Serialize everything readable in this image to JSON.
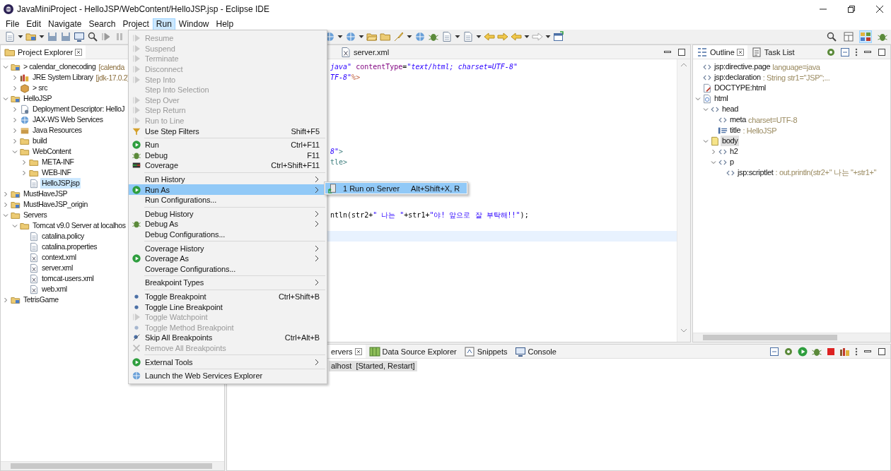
{
  "window": {
    "title": "JavaMiniProject - HelloJSP/WebContent/HelloJSP.jsp - Eclipse IDE"
  },
  "menubar": [
    {
      "label": "File",
      "selected": false
    },
    {
      "label": "Edit",
      "selected": false
    },
    {
      "label": "Navigate",
      "selected": false
    },
    {
      "label": "Search",
      "selected": false
    },
    {
      "label": "Project",
      "selected": false
    },
    {
      "label": "Run",
      "selected": true
    },
    {
      "label": "Window",
      "selected": false
    },
    {
      "label": "Help",
      "selected": false
    }
  ],
  "project_explorer": {
    "tab": {
      "label": "Project Explorer",
      "selected": true
    },
    "items": [
      {
        "label": "> calendar_clonecoding",
        "detail": "[calenda",
        "kind": "project",
        "expanded": true,
        "selected": false,
        "children": [
          {
            "label": "JRE System Library",
            "detail": "[jdk-17.0.2]",
            "kind": "library",
            "expanded": false,
            "selected": false
          },
          {
            "label": "> src",
            "kind": "source",
            "expanded": false,
            "selected": false
          }
        ]
      },
      {
        "label": "HelloJSP",
        "kind": "project",
        "expanded": true,
        "selected": false,
        "children": [
          {
            "label": "Deployment Descriptor: HelloJ",
            "kind": "descriptor",
            "expanded": false,
            "selected": false
          },
          {
            "label": "JAX-WS Web Services",
            "kind": "services",
            "expanded": false,
            "selected": false
          },
          {
            "label": "Java Resources",
            "kind": "resources",
            "expanded": false,
            "selected": false
          },
          {
            "label": "build",
            "kind": "folder",
            "expanded": false,
            "selected": false
          },
          {
            "label": "WebContent",
            "kind": "folder",
            "expanded": true,
            "selected": false,
            "children": [
              {
                "label": "META-INF",
                "kind": "folder",
                "expanded": false,
                "selected": false
              },
              {
                "label": "WEB-INF",
                "kind": "folder",
                "expanded": false,
                "selected": false
              },
              {
                "label": "HelloJSP.jsp",
                "kind": "file",
                "selected": true
              }
            ]
          }
        ]
      },
      {
        "label": "MustHaveJSP",
        "kind": "project",
        "expanded": false,
        "selected": false
      },
      {
        "label": "MustHaveJSP_origin",
        "kind": "project",
        "expanded": false,
        "selected": false
      },
      {
        "label": "Servers",
        "kind": "folder",
        "expanded": true,
        "selected": false,
        "children": [
          {
            "label": "Tomcat v9.0 Server at localhos",
            "kind": "folder",
            "expanded": true,
            "selected": false,
            "children": [
              {
                "label": "catalina.policy",
                "kind": "file",
                "selected": false
              },
              {
                "label": "catalina.properties",
                "kind": "file",
                "selected": false
              },
              {
                "label": "context.xml",
                "kind": "xml",
                "selected": false
              },
              {
                "label": "server.xml",
                "kind": "xml",
                "selected": false
              },
              {
                "label": "tomcat-users.xml",
                "kind": "xml",
                "selected": false
              },
              {
                "label": "web.xml",
                "kind": "xml",
                "selected": false
              }
            ]
          }
        ]
      },
      {
        "label": "TetrisGame",
        "kind": "project",
        "expanded": false,
        "selected": false
      }
    ]
  },
  "editor": {
    "tabs": [
      {
        "label": "server.xml",
        "selected": false
      }
    ],
    "lines": [
      {
        "kind": "code",
        "segments": [
          {
            "text": "java\"",
            "kind": "string"
          },
          {
            "text": " contentType",
            "kind": "attr"
          },
          {
            "text": "=",
            "kind": "plain"
          },
          {
            "text": "\"text/html; charset=UTF-8\"",
            "kind": "string"
          }
        ]
      },
      {
        "kind": "code",
        "segments": [
          {
            "text": "TF-8\"",
            "kind": "string"
          },
          {
            "text": "%>",
            "kind": "delim"
          }
        ]
      },
      {
        "kind": "blank"
      },
      {
        "kind": "blank"
      },
      {
        "kind": "blank"
      },
      {
        "kind": "blank"
      },
      {
        "kind": "blank"
      },
      {
        "kind": "blank"
      },
      {
        "kind": "code",
        "segments": [
          {
            "text": "8\"",
            "kind": "string"
          },
          {
            "text": ">",
            "kind": "tag"
          }
        ]
      },
      {
        "kind": "code",
        "segments": [
          {
            "text": "tle>",
            "kind": "tag"
          }
        ]
      },
      {
        "kind": "blank"
      },
      {
        "kind": "blank"
      },
      {
        "kind": "blank"
      },
      {
        "kind": "blank"
      },
      {
        "kind": "code",
        "segments": [
          {
            "text": "ntln(str2+",
            "kind": "plain"
          },
          {
            "text": "\" 나는 \"",
            "kind": "jstring"
          },
          {
            "text": "+str1+",
            "kind": "plain"
          },
          {
            "text": "\"야! 앞으로 잘 부탁해!!\"",
            "kind": "jstring"
          },
          {
            "text": ");",
            "kind": "plain"
          }
        ]
      },
      {
        "kind": "blank"
      },
      {
        "kind": "blank",
        "current": true
      }
    ]
  },
  "outline": {
    "tabs": [
      {
        "label": "Outline",
        "selected": true
      },
      {
        "label": "Task List",
        "selected": false
      }
    ],
    "items": [
      {
        "label": "jsp:directive.page",
        "detail": "language=java",
        "kind": "tag",
        "selected": false
      },
      {
        "label": "jsp:declaration",
        "detail": ": String str1=\"JSP\";...",
        "kind": "tag",
        "selected": false
      },
      {
        "label": "DOCTYPE:html",
        "kind": "doctype",
        "selected": false
      },
      {
        "label": "html",
        "kind": "html",
        "expanded": true,
        "selected": false,
        "children": [
          {
            "label": "head",
            "kind": "tag",
            "expanded": true,
            "selected": false,
            "children": [
              {
                "label": "meta",
                "detail": "charset=UTF-8",
                "kind": "tag",
                "selected": false
              },
              {
                "label": "title",
                "detail": ": HelloJSP",
                "kind": "title",
                "selected": false
              }
            ]
          },
          {
            "label": "body",
            "kind": "body",
            "expanded": true,
            "selected": true,
            "children": [
              {
                "label": "h2",
                "kind": "tag",
                "expanded": false,
                "selected": false
              },
              {
                "label": "p",
                "kind": "tag",
                "expanded": true,
                "selected": false,
                "children": [
                  {
                    "label": "jsp:scriptlet",
                    "detail": ": out.println(str2+\" 나는 \"+str1+\"",
                    "kind": "tag",
                    "selected": false
                  }
                ]
              }
            ]
          }
        ]
      }
    ]
  },
  "bottom_panel": {
    "tabs": [
      {
        "label": "ervers",
        "selected": true
      },
      {
        "label": "Data Source Explorer",
        "selected": false
      },
      {
        "label": "Snippets",
        "selected": false
      },
      {
        "label": "Console",
        "selected": false
      }
    ],
    "rows": [
      {
        "label": "alhost  [Started, Restart]",
        "selected": true
      }
    ]
  },
  "run_menu": {
    "groups": [
      {
        "items": [
          {
            "label": "Resume",
            "kind": "step",
            "disabled": true,
            "submenu": false,
            "selected": false
          },
          {
            "label": "Suspend",
            "kind": "step",
            "disabled": true,
            "submenu": false,
            "selected": false
          },
          {
            "label": "Terminate",
            "kind": "step",
            "disabled": true,
            "submenu": false,
            "selected": false
          },
          {
            "label": "Disconnect",
            "kind": "step",
            "disabled": true,
            "submenu": false,
            "selected": false
          },
          {
            "label": "Step Into",
            "kind": "step",
            "disabled": true,
            "submenu": false,
            "selected": false
          },
          {
            "label": "Step Into Selection",
            "kind": "plain",
            "disabled": true,
            "submenu": false,
            "selected": false
          },
          {
            "label": "Step Over",
            "kind": "step",
            "disabled": true,
            "submenu": false,
            "selected": false
          },
          {
            "label": "Step Return",
            "kind": "step",
            "disabled": true,
            "submenu": false,
            "selected": false
          },
          {
            "label": "Run to Line",
            "kind": "step",
            "disabled": true,
            "submenu": false,
            "selected": false
          },
          {
            "label": "Use Step Filters",
            "shortcut": "Shift+F5",
            "kind": "filter",
            "disabled": false,
            "submenu": false,
            "selected": false
          }
        ]
      },
      {
        "items": [
          {
            "label": "Run",
            "shortcut": "Ctrl+F11",
            "kind": "run",
            "disabled": false,
            "submenu": false,
            "selected": false
          },
          {
            "label": "Debug",
            "shortcut": "F11",
            "kind": "debug",
            "disabled": false,
            "submenu": false,
            "selected": false
          },
          {
            "label": "Coverage",
            "shortcut": "Ctrl+Shift+F11",
            "kind": "coverage",
            "disabled": false,
            "submenu": false,
            "selected": false
          }
        ]
      },
      {
        "items": [
          {
            "label": "Run History",
            "kind": "plain",
            "disabled": false,
            "submenu": true,
            "selected": false
          },
          {
            "label": "Run As",
            "kind": "run",
            "disabled": false,
            "submenu": true,
            "selected": true
          },
          {
            "label": "Run Configurations...",
            "kind": "plain",
            "disabled": false,
            "submenu": false,
            "selected": false
          }
        ]
      },
      {
        "items": [
          {
            "label": "Debug History",
            "kind": "plain",
            "disabled": false,
            "submenu": true,
            "selected": false
          },
          {
            "label": "Debug As",
            "kind": "debug",
            "disabled": false,
            "submenu": true,
            "selected": false
          },
          {
            "label": "Debug Configurations...",
            "kind": "plain",
            "disabled": false,
            "submenu": false,
            "selected": false
          }
        ]
      },
      {
        "items": [
          {
            "label": "Coverage History",
            "kind": "plain",
            "disabled": false,
            "submenu": true,
            "selected": false
          },
          {
            "label": "Coverage As",
            "kind": "run",
            "disabled": false,
            "submenu": true,
            "selected": false
          },
          {
            "label": "Coverage Configurations...",
            "kind": "plain",
            "disabled": false,
            "submenu": false,
            "selected": false
          }
        ]
      },
      {
        "items": [
          {
            "label": "Breakpoint Types",
            "kind": "plain",
            "disabled": false,
            "submenu": true,
            "selected": false
          }
        ]
      },
      {
        "items": [
          {
            "label": "Toggle Breakpoint",
            "shortcut": "Ctrl+Shift+B",
            "kind": "breakpoint",
            "disabled": false,
            "submenu": false,
            "selected": false
          },
          {
            "label": "Toggle Line Breakpoint",
            "kind": "breakpoint",
            "disabled": false,
            "submenu": false,
            "selected": false
          },
          {
            "label": "Toggle Watchpoint",
            "kind": "step",
            "disabled": true,
            "submenu": false,
            "selected": false
          },
          {
            "label": "Toggle Method Breakpoint",
            "kind": "breakpoint",
            "disabled": true,
            "submenu": false,
            "selected": false
          },
          {
            "label": "Skip All Breakpoints",
            "shortcut": "Ctrl+Alt+B",
            "kind": "skip",
            "disabled": false,
            "submenu": false,
            "selected": false
          },
          {
            "label": "Remove All Breakpoints",
            "kind": "remove",
            "disabled": true,
            "submenu": false,
            "selected": false
          }
        ]
      },
      {
        "items": [
          {
            "label": "External Tools",
            "kind": "run",
            "disabled": false,
            "submenu": true,
            "selected": false
          }
        ]
      },
      {
        "items": [
          {
            "label": "Launch the Web Services Explorer",
            "kind": "services",
            "disabled": false,
            "submenu": false,
            "selected": false
          }
        ]
      }
    ]
  },
  "run_as_submenu": {
    "items": [
      {
        "label": "1 Run on Server",
        "shortcut": "Alt+Shift+X, R",
        "selected": true
      }
    ]
  }
}
